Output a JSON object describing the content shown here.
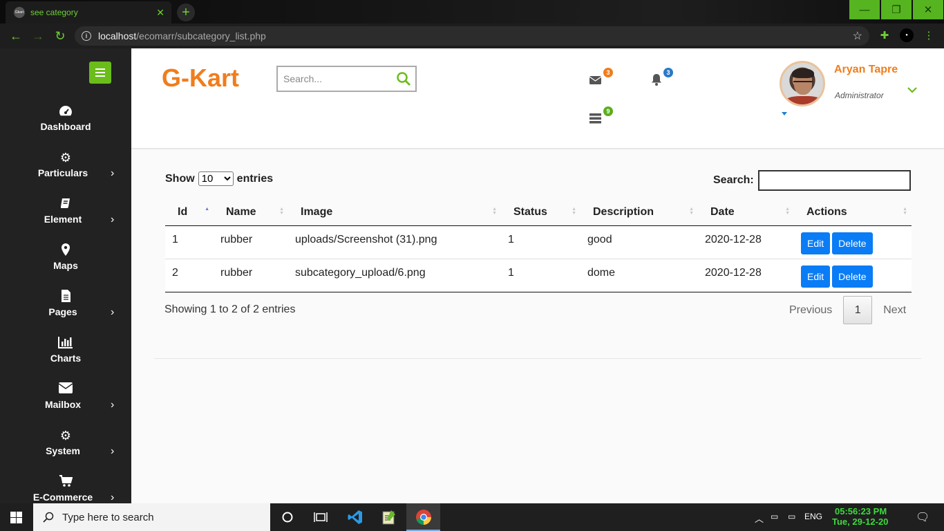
{
  "browser": {
    "tab_title": "see category",
    "favicon_text": "Gkart",
    "url_host": "localhost",
    "url_path": "/ecomarr/subcategory_list.php"
  },
  "sidebar": {
    "items": [
      {
        "label": "Dashboard",
        "icon": "dashboard-icon",
        "has_arrow": false
      },
      {
        "label": "Particulars",
        "icon": "cogs-icon",
        "has_arrow": true
      },
      {
        "label": "Element",
        "icon": "book-icon",
        "has_arrow": true
      },
      {
        "label": "Maps",
        "icon": "map-marker-icon",
        "has_arrow": false
      },
      {
        "label": "Pages",
        "icon": "file-icon",
        "has_arrow": true
      },
      {
        "label": "Charts",
        "icon": "bar-chart-icon",
        "has_arrow": false
      },
      {
        "label": "Mailbox",
        "icon": "envelope-icon",
        "has_arrow": true
      },
      {
        "label": "System",
        "icon": "gear-icon",
        "has_arrow": true
      },
      {
        "label": "E-Commerce",
        "icon": "cart-icon",
        "has_arrow": true
      }
    ]
  },
  "header": {
    "brand": "G-Kart",
    "search_placeholder": "Search...",
    "badges": {
      "mail": "3",
      "bell": "3",
      "tasks": "9"
    },
    "user_name": "Aryan Tapre",
    "user_role": "Administrator"
  },
  "table_controls": {
    "show_label": "Show",
    "entries_value": "10",
    "entries_label": "entries",
    "search_label": "Search:"
  },
  "table": {
    "headers": [
      "Id",
      "Name",
      "Image",
      "Status",
      "Description",
      "Date",
      "Actions"
    ],
    "rows": [
      {
        "id": "1",
        "name": "rubber",
        "image": "uploads/Screenshot (31).png",
        "status": "1",
        "description": "good",
        "date": "2020-12-28"
      },
      {
        "id": "2",
        "name": "rubber",
        "image": "subcategory_upload/6.png",
        "status": "1",
        "description": "dome",
        "date": "2020-12-28"
      }
    ],
    "edit_label": "Edit",
    "delete_label": "Delete"
  },
  "footer": {
    "showing": "Showing 1 to 2 of 2 entries",
    "previous": "Previous",
    "current_page": "1",
    "next": "Next"
  },
  "taskbar": {
    "search_placeholder": "Type here to search",
    "lang": "ENG",
    "time": "05:56:23 PM",
    "date": "Tue, 29-12-20"
  },
  "colors": {
    "accent_green": "#6bbd1a",
    "brand_orange": "#f07d1c",
    "button_blue": "#0a7cf5",
    "sidebar_bg": "#222222"
  }
}
